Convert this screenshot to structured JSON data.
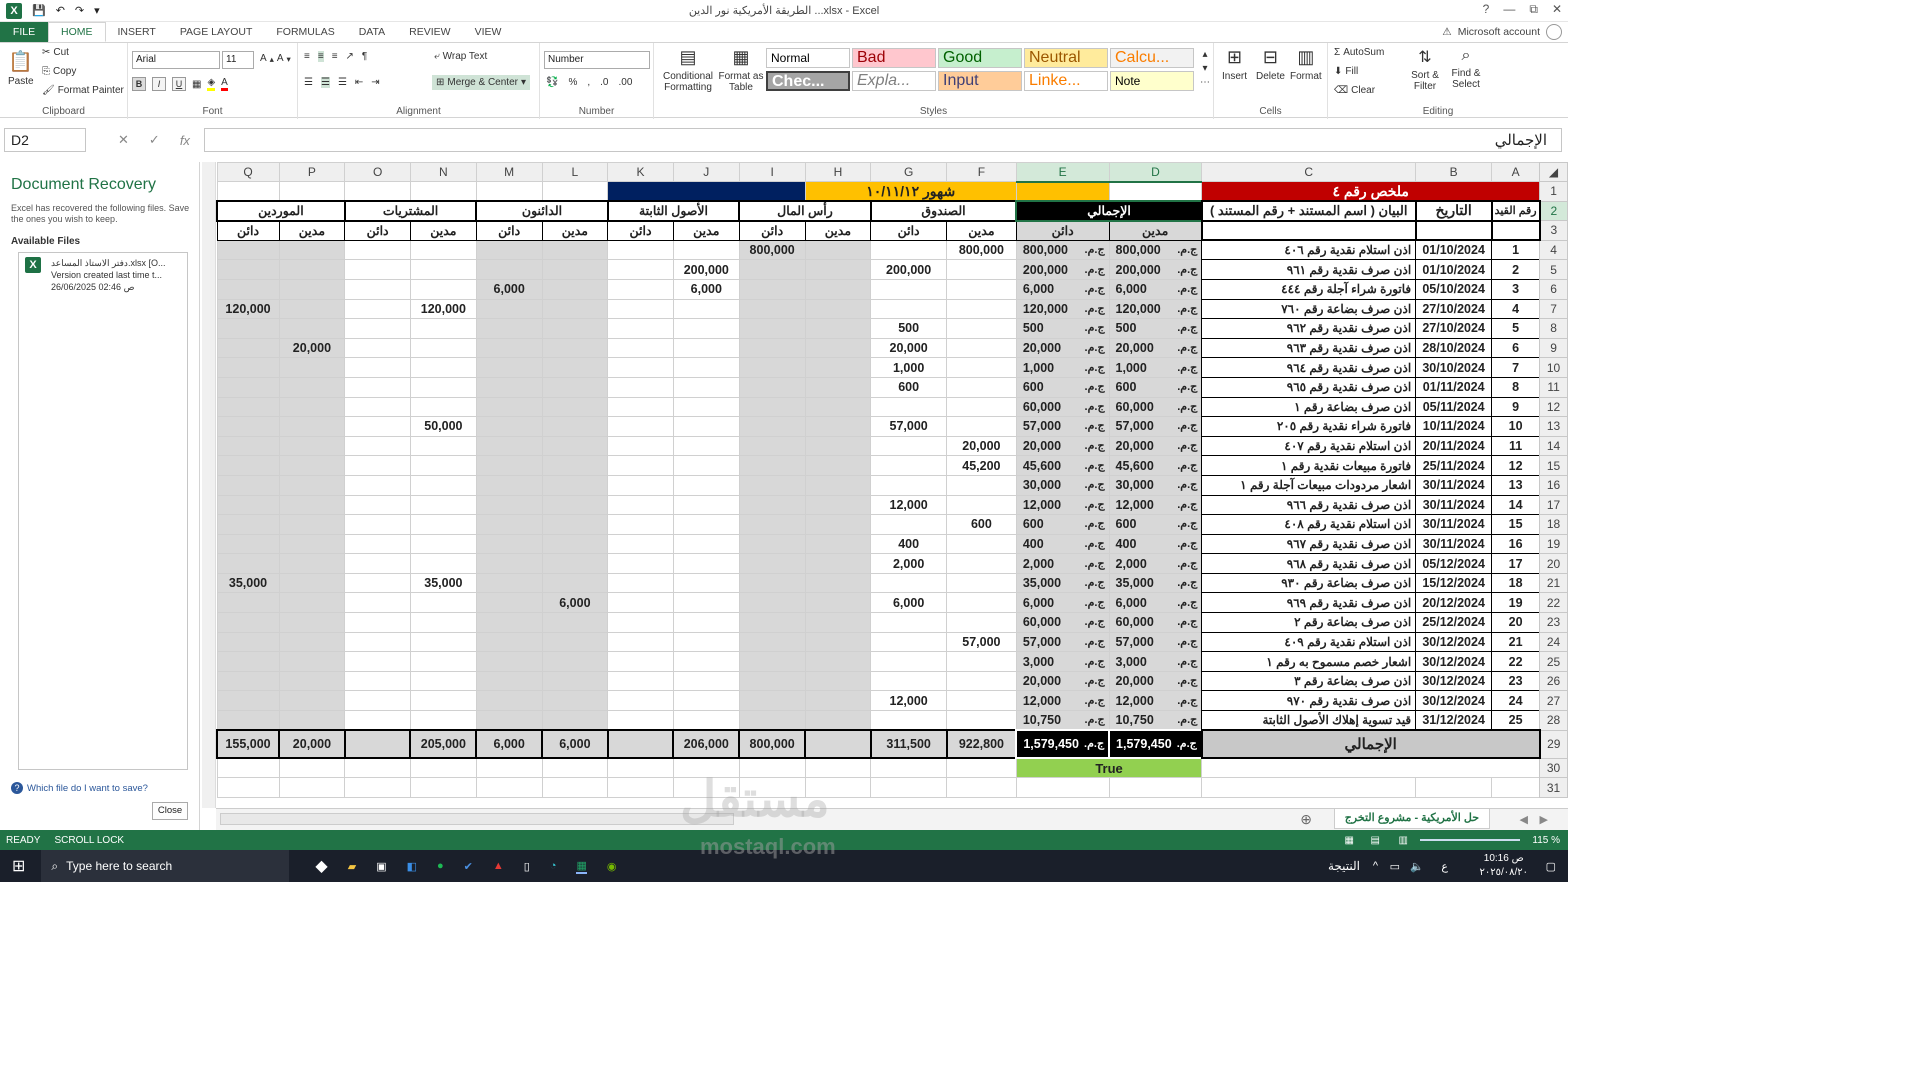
{
  "window": {
    "title": "الطريقة الأمريكية نور الدين ...xlsx - Excel",
    "help": "?",
    "minimize": "—",
    "restore": "⧉",
    "close": "✕"
  },
  "tabs": [
    {
      "label": "FILE"
    },
    {
      "label": "HOME"
    },
    {
      "label": "INSERT"
    },
    {
      "label": "PAGE LAYOUT"
    },
    {
      "label": "FORMULAS"
    },
    {
      "label": "DATA"
    },
    {
      "label": "REVIEW"
    },
    {
      "label": "VIEW"
    }
  ],
  "account": {
    "label": "Microsoft account"
  },
  "ribbon": {
    "clipboard": {
      "name": "Clipboard",
      "paste": "Paste",
      "cut": "Cut",
      "copy": "Copy",
      "format_painter": "Format Painter"
    },
    "font": {
      "name": "Font",
      "family": "Arial",
      "size": "11",
      "bold": "B",
      "italic": "I",
      "underline": "U"
    },
    "alignment": {
      "name": "Alignment",
      "wrap": "Wrap Text",
      "merge": "Merge & Center"
    },
    "number": {
      "name": "Number",
      "format": "Number",
      "percent": "%",
      "comma": ","
    },
    "styles": {
      "name": "Styles",
      "conditional": "Conditional Formatting",
      "format_table": "Format as Table",
      "cells": [
        {
          "label": "Normal",
          "bg": "#ffffff",
          "fg": "#000000"
        },
        {
          "label": "Bad",
          "bg": "#ffc7ce",
          "fg": "#9c0006"
        },
        {
          "label": "Good",
          "bg": "#c6efce",
          "fg": "#006100"
        },
        {
          "label": "Neutral",
          "bg": "#ffeb9c",
          "fg": "#9c5700"
        },
        {
          "label": "Calcu...",
          "bg": "#f2f2f2",
          "fg": "#fa7d00"
        },
        {
          "label": "Chec...",
          "bg": "#a5a5a5",
          "fg": "#ffffff"
        },
        {
          "label": "Expla...",
          "bg": "#ffffff",
          "fg": "#7f7f7f"
        },
        {
          "label": "Input",
          "bg": "#ffcc99",
          "fg": "#3f3f76"
        },
        {
          "label": "Linke...",
          "bg": "#ffffff",
          "fg": "#fa7d00"
        },
        {
          "label": "Note",
          "bg": "#ffffcc",
          "fg": "#000000"
        }
      ]
    },
    "cells": {
      "name": "Cells",
      "insert": "Insert",
      "delete": "Delete",
      "format": "Format"
    },
    "editing": {
      "name": "Editing",
      "autosum": "AutoSum",
      "fill": "Fill",
      "clear": "Clear",
      "sort": "Sort & Filter",
      "find": "Find & Select"
    }
  },
  "formula_bar": {
    "name_box": "D2",
    "fx": "fx",
    "value": "الإجمالي"
  },
  "recovery": {
    "title": "Document Recovery",
    "desc": "Excel has recovered the following files. Save the ones you wish to keep.",
    "available": "Available Files",
    "file_name": "دفتر الاستاذ المساعد.xlsx  [O...",
    "file_version": "Version created last time t...",
    "file_date": "26/06/2025 02:46 ص",
    "help": "Which file do I want to save?",
    "close": "Close"
  },
  "columns": [
    "A",
    "B",
    "C",
    "D",
    "E",
    "F",
    "G",
    "H",
    "I",
    "J",
    "K",
    "L",
    "M",
    "N",
    "O",
    "P",
    "Q"
  ],
  "sheet": {
    "r1_title": "ملخص رقم ٤",
    "r1_month": "شهور ١٠/١١/١٢",
    "r2": {
      "a": "رقم القيد",
      "b": "التاريخ",
      "c": "البيان ( اسم المستند + رقم المستند )",
      "total": "الإجمالي",
      "cash": "الصندوق",
      "capital": "رأس المال",
      "fixed": "الأصول الثابتة",
      "creditors": "الدائنون",
      "purchases": "المشتريات",
      "suppliers": "الموردين"
    },
    "debit": "مدين",
    "credit": "دائن",
    "currency": "ج.م.",
    "rows": [
      {
        "n": "1",
        "date": "01/10/2024",
        "desc": "اذن استلام نقدية رقم ٤٠٦",
        "amt": "800,000",
        "f": "800,000",
        "g": "",
        "i": "800,000",
        "j": "",
        "m": "",
        "n2": "",
        "p": "",
        "q": ""
      },
      {
        "n": "2",
        "date": "01/10/2024",
        "desc": "اذن صرف نقدية رقم ٩٦١",
        "amt": "200,000",
        "f": "",
        "g": "200,000",
        "i": "",
        "j": "200,000",
        "m": "",
        "n2": "",
        "p": "",
        "q": ""
      },
      {
        "n": "3",
        "date": "05/10/2024",
        "desc": "فاتورة شراء آجلة رقم ٤٤٤",
        "amt": "6,000",
        "f": "",
        "g": "",
        "i": "",
        "j": "6,000",
        "m": "6,000",
        "n2": "",
        "p": "",
        "q": ""
      },
      {
        "n": "4",
        "date": "27/10/2024",
        "desc": "اذن صرف بضاعة رقم ٧٦٠",
        "amt": "120,000",
        "f": "",
        "g": "",
        "i": "",
        "j": "",
        "m": "",
        "n2": "120,000",
        "p": "",
        "q": "120,000"
      },
      {
        "n": "5",
        "date": "27/10/2024",
        "desc": "اذن صرف نقدية رقم ٩٦٢",
        "amt": "500",
        "f": "",
        "g": "500",
        "i": "",
        "j": "",
        "m": "",
        "n2": "",
        "p": "",
        "q": ""
      },
      {
        "n": "6",
        "date": "28/10/2024",
        "desc": "اذن صرف نقدية رقم ٩٦٣",
        "amt": "20,000",
        "f": "",
        "g": "20,000",
        "i": "",
        "j": "",
        "m": "",
        "n2": "",
        "p": "20,000",
        "q": ""
      },
      {
        "n": "7",
        "date": "30/10/2024",
        "desc": "اذن صرف نقدية رقم ٩٦٤",
        "amt": "1,000",
        "f": "",
        "g": "1,000",
        "i": "",
        "j": "",
        "m": "",
        "n2": "",
        "p": "",
        "q": ""
      },
      {
        "n": "8",
        "date": "01/11/2024",
        "desc": "اذن صرف نقدية رقم ٩٦٥",
        "amt": "600",
        "f": "",
        "g": "600",
        "i": "",
        "j": "",
        "m": "",
        "n2": "",
        "p": "",
        "q": ""
      },
      {
        "n": "9",
        "date": "05/11/2024",
        "desc": "اذن صرف بضاعة رقم ١",
        "amt": "60,000",
        "f": "",
        "g": "",
        "i": "",
        "j": "",
        "m": "",
        "n2": "",
        "p": "",
        "q": ""
      },
      {
        "n": "10",
        "date": "10/11/2024",
        "desc": "فاتورة شراء نقدية رقم ٢٠٥",
        "amt": "57,000",
        "f": "",
        "g": "57,000",
        "i": "",
        "j": "",
        "m": "",
        "n2": "50,000",
        "p": "",
        "q": ""
      },
      {
        "n": "11",
        "date": "20/11/2024",
        "desc": "اذن استلام نقدية رقم ٤٠٧",
        "amt": "20,000",
        "f": "20,000",
        "g": "",
        "i": "",
        "j": "",
        "m": "",
        "n2": "",
        "p": "",
        "q": ""
      },
      {
        "n": "12",
        "date": "25/11/2024",
        "desc": "فاتورة مبيعات نقدية رقم ١",
        "amt": "45,600",
        "f": "45,200",
        "g": "",
        "i": "",
        "j": "",
        "m": "",
        "n2": "",
        "p": "",
        "q": ""
      },
      {
        "n": "13",
        "date": "30/11/2024",
        "desc": "اشعار مردودات مبيعات آجلة رقم ١",
        "amt": "30,000",
        "f": "",
        "g": "",
        "i": "",
        "j": "",
        "m": "",
        "n2": "",
        "p": "",
        "q": ""
      },
      {
        "n": "14",
        "date": "30/11/2024",
        "desc": "اذن صرف نقدية رقم ٩٦٦",
        "amt": "12,000",
        "f": "",
        "g": "12,000",
        "i": "",
        "j": "",
        "m": "",
        "n2": "",
        "p": "",
        "q": ""
      },
      {
        "n": "15",
        "date": "30/11/2024",
        "desc": "اذن استلام نقدية رقم ٤٠٨",
        "amt": "600",
        "f": "600",
        "g": "",
        "i": "",
        "j": "",
        "m": "",
        "n2": "",
        "p": "",
        "q": ""
      },
      {
        "n": "16",
        "date": "30/11/2024",
        "desc": "اذن صرف نقدية رقم ٩٦٧",
        "amt": "400",
        "f": "",
        "g": "400",
        "i": "",
        "j": "",
        "m": "",
        "n2": "",
        "p": "",
        "q": ""
      },
      {
        "n": "17",
        "date": "05/12/2024",
        "desc": "اذن صرف نقدية رقم ٩٦٨",
        "amt": "2,000",
        "f": "",
        "g": "2,000",
        "i": "",
        "j": "",
        "m": "",
        "n2": "",
        "p": "",
        "q": ""
      },
      {
        "n": "18",
        "date": "15/12/2024",
        "desc": "اذن صرف بضاعة رقم ٩٣٠",
        "amt": "35,000",
        "f": "",
        "g": "",
        "i": "",
        "j": "",
        "m": "",
        "n2": "35,000",
        "p": "",
        "q": "35,000"
      },
      {
        "n": "19",
        "date": "20/12/2024",
        "desc": "اذن صرف نقدية رقم ٩٦٩",
        "amt": "6,000",
        "f": "",
        "g": "6,000",
        "i": "",
        "j": "",
        "m": "",
        "l": "6,000",
        "n2": "",
        "p": "",
        "q": ""
      },
      {
        "n": "20",
        "date": "25/12/2024",
        "desc": "اذن صرف بضاعة رقم ٢",
        "amt": "60,000",
        "f": "",
        "g": "",
        "i": "",
        "j": "",
        "m": "",
        "n2": "",
        "p": "",
        "q": ""
      },
      {
        "n": "21",
        "date": "30/12/2024",
        "desc": "اذن استلام نقدية رقم ٤٠٩",
        "amt": "57,000",
        "f": "57,000",
        "g": "",
        "i": "",
        "j": "",
        "m": "",
        "n2": "",
        "p": "",
        "q": ""
      },
      {
        "n": "22",
        "date": "30/12/2024",
        "desc": "اشعار خصم مسموح به رقم ١",
        "amt": "3,000",
        "f": "",
        "g": "",
        "i": "",
        "j": "",
        "m": "",
        "n2": "",
        "p": "",
        "q": ""
      },
      {
        "n": "23",
        "date": "30/12/2024",
        "desc": "اذن صرف بضاعة رقم ٣",
        "amt": "20,000",
        "f": "",
        "g": "",
        "i": "",
        "j": "",
        "m": "",
        "n2": "",
        "p": "",
        "q": ""
      },
      {
        "n": "24",
        "date": "30/12/2024",
        "desc": "اذن صرف نقدية رقم ٩٧٠",
        "amt": "12,000",
        "f": "",
        "g": "12,000",
        "i": "",
        "j": "",
        "m": "",
        "n2": "",
        "p": "",
        "q": ""
      },
      {
        "n": "25",
        "date": "31/12/2024",
        "desc": "قيد تسوية إهلاك الأصول الثابتة",
        "amt": "10,750",
        "f": "",
        "g": "",
        "i": "",
        "j": "",
        "m": "",
        "n2": "",
        "p": "",
        "q": ""
      }
    ],
    "totals": {
      "label": "الإجمالي",
      "d": "1,579,450",
      "e": "1,579,450",
      "f": "922,800",
      "g": "311,500",
      "h": "",
      "i": "800,000",
      "j": "206,000",
      "k": "",
      "l": "6,000",
      "m": "6,000",
      "n": "205,000",
      "o": "",
      "p": "20,000",
      "q": "155,000"
    },
    "check": "True"
  },
  "sheet_tab": "حل الأمريكية - مشروع التخرج",
  "status": {
    "ready": "READY",
    "scroll": "SCROLL LOCK",
    "zoom": "115 %"
  },
  "taskbar": {
    "search": "Type here to search",
    "time": "10:16 ص",
    "date": "٢٠٢٥/٠٨/٢٠",
    "results": "النتيجة",
    "lang": "ع"
  },
  "watermark": {
    "ar": "مستقل",
    "url": "mostaql.com"
  }
}
